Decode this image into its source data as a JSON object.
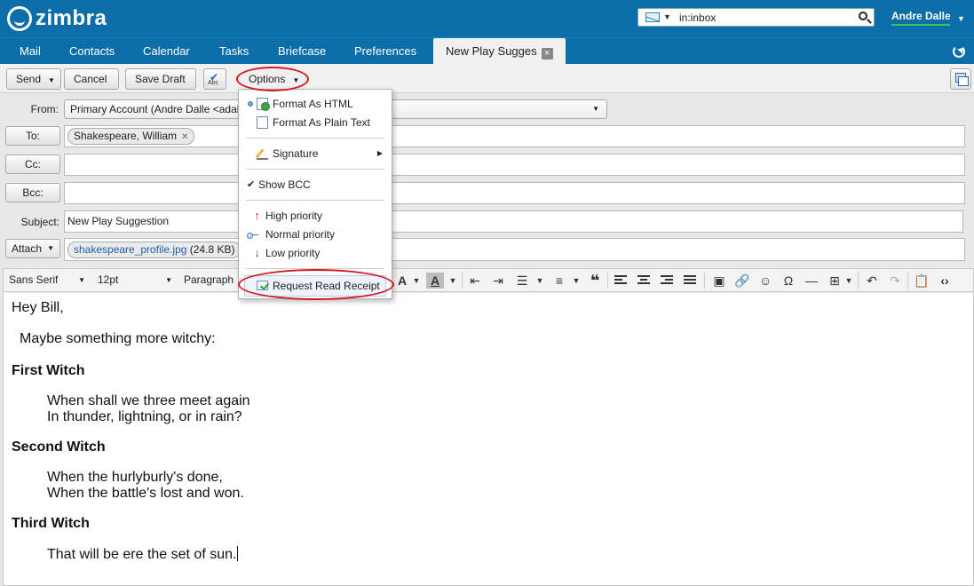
{
  "app": {
    "logo_text": "zimbra"
  },
  "search": {
    "value": "in:inbox"
  },
  "user": {
    "name": "Andre Dalle"
  },
  "tabs": [
    {
      "label": "Mail"
    },
    {
      "label": "Contacts"
    },
    {
      "label": "Calendar"
    },
    {
      "label": "Tasks"
    },
    {
      "label": "Briefcase"
    },
    {
      "label": "Preferences"
    },
    {
      "label": "New Play Sugges"
    }
  ],
  "toolbar": {
    "send": "Send",
    "cancel": "Cancel",
    "save_draft": "Save Draft",
    "spell_abc": "Abc",
    "options": "Options"
  },
  "compose": {
    "from_label": "From:",
    "from_value": "Primary Account (Andre Dalle <adal",
    "to_label": "To:",
    "to_recipient": "Shakespeare, William",
    "cc_label": "Cc:",
    "bcc_label": "Bcc:",
    "subject_label": "Subject:",
    "subject_value": "New Play Suggestion",
    "attach_label": "Attach",
    "attachment_name": "shakespeare_profile.jpg",
    "attachment_size": "(24.8 KB)"
  },
  "editor": {
    "font_family": "Sans Serif",
    "font_size": "12pt",
    "block_format": "Paragraph"
  },
  "body": {
    "greeting": "Hey Bill,",
    "intro": "Maybe something more witchy:",
    "h1": "First Witch",
    "l1a": "When shall we three meet again",
    "l1b": "In thunder, lightning, or in rain?",
    "h2": "Second Witch",
    "l2a": "When the hurlyburly's done,",
    "l2b": "When the battle's lost and won.",
    "h3": "Third Witch",
    "l3a": "That will be ere the set of sun."
  },
  "options_menu": {
    "format_html": "Format As HTML",
    "format_plain": "Format As Plain Text",
    "signature": "Signature",
    "show_bcc": "Show BCC",
    "high_priority": "High priority",
    "normal_priority": "Normal priority",
    "low_priority": "Low priority",
    "read_receipt": "Request Read Receipt"
  },
  "colors": {
    "header": "#0b6ea8",
    "annotation": "#d9141b",
    "presence": "#3fc05a"
  }
}
